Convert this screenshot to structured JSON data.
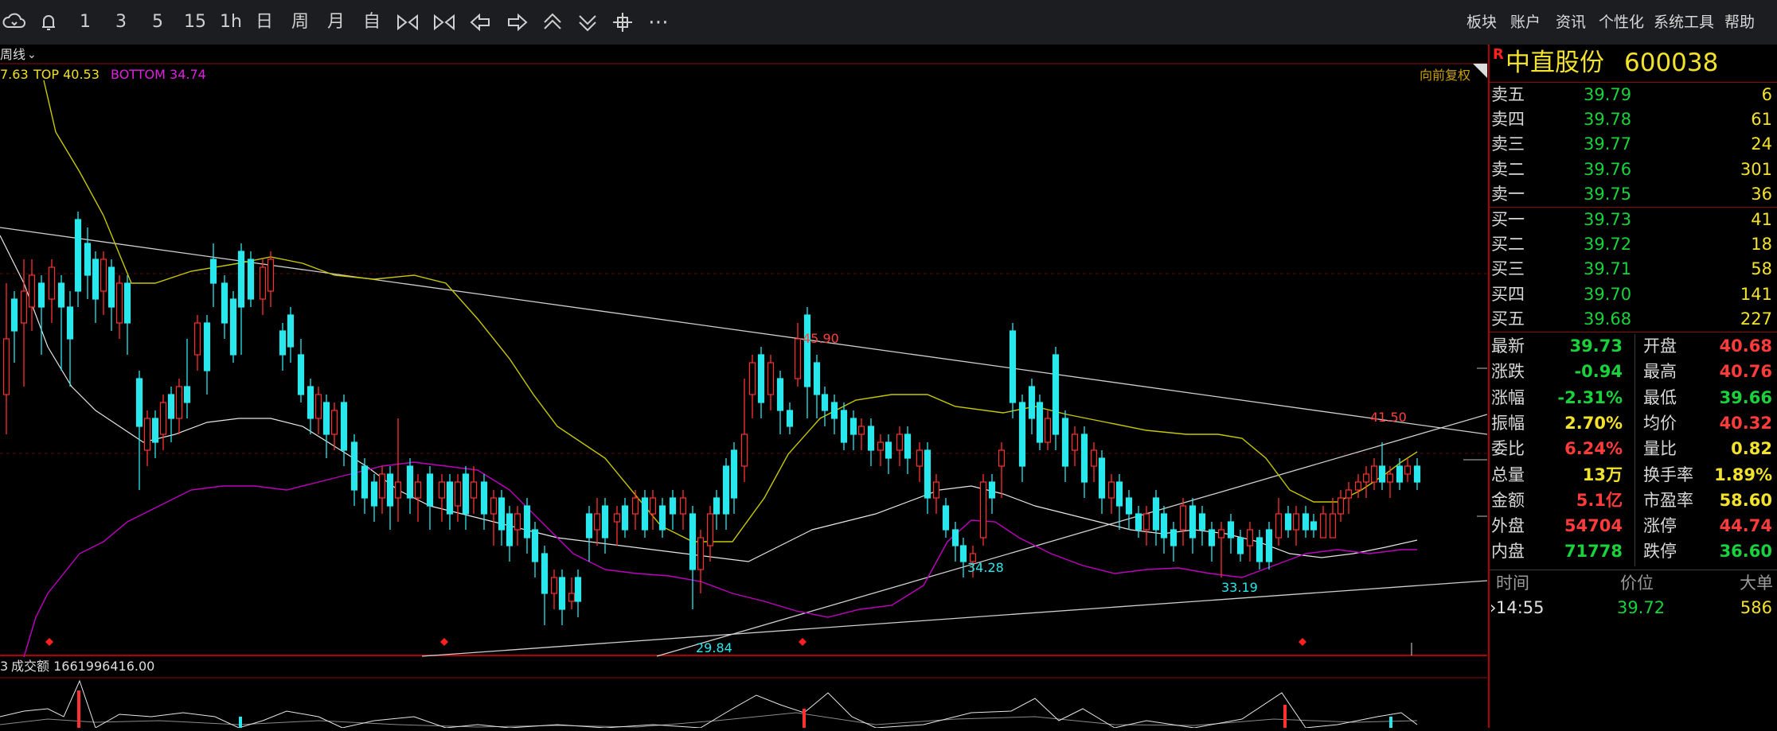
{
  "toolbar": {
    "periods": [
      "1",
      "3",
      "5",
      "15",
      "1h",
      "日",
      "周",
      "月",
      "自"
    ],
    "menu": [
      "板块",
      "账户",
      "资讯",
      "个性化",
      "系统工具",
      "帮助"
    ]
  },
  "chart": {
    "period_label": "周线",
    "indicator_prefix": "7.63",
    "top_label": "TOP 40.53",
    "bottom_label": "BOTTOM 34.74",
    "adjust_label": "向前复权",
    "volume_label": "成交额 1661996416.00",
    "volume_prefix": "3",
    "colors": {
      "up": "#ff3030",
      "down": "#28e8ee",
      "top": "#c8c800",
      "bottom": "#c000c0",
      "mid": "#e6e6e6"
    }
  },
  "chart_data": {
    "type": "candlestick",
    "annotations": [
      {
        "label": "45.90",
        "kind": "high"
      },
      {
        "label": "41.50",
        "kind": "high"
      },
      {
        "label": "34.28",
        "kind": "low"
      },
      {
        "label": "33.19",
        "kind": "low"
      },
      {
        "label": "29.84",
        "kind": "low"
      }
    ],
    "indicator": {
      "top": 40.53,
      "bottom": 34.74
    },
    "volume_amount": 1661996416.0
  },
  "quote": {
    "marker": "R",
    "name": "中直股份",
    "code": "600038",
    "sell": [
      {
        "label": "卖五",
        "price": "39.79",
        "vol": "6"
      },
      {
        "label": "卖四",
        "price": "39.78",
        "vol": "61"
      },
      {
        "label": "卖三",
        "price": "39.77",
        "vol": "24"
      },
      {
        "label": "卖二",
        "price": "39.76",
        "vol": "301"
      },
      {
        "label": "卖一",
        "price": "39.75",
        "vol": "36"
      }
    ],
    "buy": [
      {
        "label": "买一",
        "price": "39.73",
        "vol": "41"
      },
      {
        "label": "买二",
        "price": "39.72",
        "vol": "18"
      },
      {
        "label": "买三",
        "price": "39.71",
        "vol": "58"
      },
      {
        "label": "买四",
        "price": "39.70",
        "vol": "141"
      },
      {
        "label": "买五",
        "price": "39.68",
        "vol": "227"
      }
    ],
    "stats": [
      {
        "l1": "最新",
        "v1": "39.73",
        "c1": "grn",
        "l2": "开盘",
        "v2": "40.68",
        "c2": "red"
      },
      {
        "l1": "涨跌",
        "v1": "-0.94",
        "c1": "grn",
        "l2": "最高",
        "v2": "40.76",
        "c2": "red"
      },
      {
        "l1": "涨幅",
        "v1": "-2.31%",
        "c1": "grn",
        "l2": "最低",
        "v2": "39.66",
        "c2": "grn"
      },
      {
        "l1": "振幅",
        "v1": "2.70%",
        "c1": "yel",
        "l2": "均价",
        "v2": "40.32",
        "c2": "red"
      },
      {
        "l1": "委比",
        "v1": "6.24%",
        "c1": "red",
        "l2": "量比",
        "v2": "0.82",
        "c2": "yel"
      },
      {
        "l1": "总量",
        "v1": "13万",
        "c1": "yel",
        "l2": "换手率",
        "v2": "1.89%",
        "c2": "yel"
      },
      {
        "l1": "金额",
        "v1": "5.1亿",
        "c1": "red",
        "l2": "市盈率",
        "v2": "58.60",
        "c2": "yel"
      },
      {
        "l1": "外盘",
        "v1": "54704",
        "c1": "red",
        "l2": "涨停",
        "v2": "44.74",
        "c2": "red"
      },
      {
        "l1": "内盘",
        "v1": "71778",
        "c1": "grn",
        "l2": "跌停",
        "v2": "36.60",
        "c2": "grn"
      }
    ],
    "ticks_header": {
      "time": "时间",
      "price": "价位",
      "big": "大单"
    },
    "ticks": [
      {
        "time": "14:55",
        "price": "39.72",
        "vol": "586"
      }
    ]
  }
}
